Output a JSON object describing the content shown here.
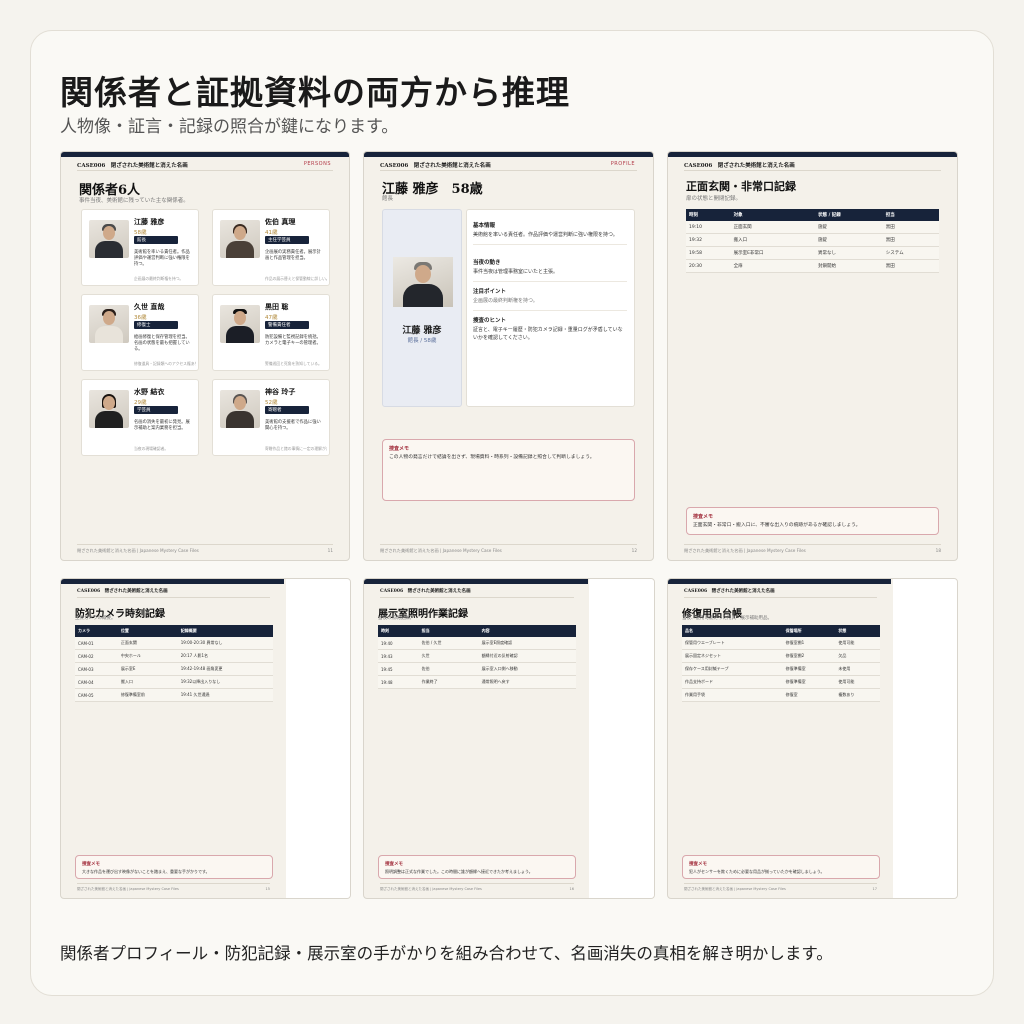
{
  "headline": "関係者と証拠資料の両方から推理",
  "subhead": "人物像・証言・記録の照合が鍵になります。",
  "footer": "関係者プロフィール・防犯記録・展示室の手がかりを組み合わせて、名画消失の真相を解き明かします。",
  "common": {
    "case": "CASE006　閉ざされた美術館と消えた名画",
    "foot": "閉ざされた美術館と消えた名画 | Japanese Mystery Case Files",
    "memo_title": "捜査メモ"
  },
  "p1": {
    "tag": "PERSONS",
    "title": "関係者6人",
    "sub": "事件当夜、美術館に残っていた主な関係者。",
    "page": "11",
    "persons": [
      {
        "name": "江藤 雅彦",
        "age": "58歳",
        "role": "館長",
        "desc": "美術館を率いる責任者。作品評価や運営判断に強い権限を持つ。",
        "note": "企画展の最終判断権を持つ。"
      },
      {
        "name": "佐伯 真理",
        "age": "41歳",
        "role": "主任学芸員",
        "desc": "企画展の実務責任者。展示計画と作品管理を担当。",
        "note": "作品の展示替えと保管動線に詳しい。"
      },
      {
        "name": "久世 直哉",
        "age": "36歳",
        "role": "修復士",
        "desc": "絵画修復と保存管理を担当。名画の状態を最も把握している。",
        "note": "修復道具・記録類へのアクセス権あり。"
      },
      {
        "name": "黒田 聡",
        "age": "47歳",
        "role": "警備責任者",
        "desc": "防犯設備と監視記録を統括。カメラと電子キーの管理者。",
        "note": "警備巡回と死角を熟知している。"
      },
      {
        "name": "水野 結衣",
        "age": "29歳",
        "role": "学芸員",
        "desc": "名画の消失を最初に発見。展示補助と案内業務を担当。",
        "note": "当夜の現場確認者。"
      },
      {
        "name": "神谷 玲子",
        "age": "52歳",
        "role": "寄贈者",
        "desc": "美術館の支援者で作品に強い関心を持つ。",
        "note": "寄贈作品と館の事情に一定の理解がある。"
      }
    ]
  },
  "p2": {
    "tag": "PROFILE",
    "title": "江藤 雅彦　58歳",
    "sub": "館長",
    "page": "12",
    "photo_name": "江藤 雅彦",
    "photo_sub": "館長 / 58歳",
    "sections": [
      {
        "h": "基本情報",
        "b": "美術館を率いる責任者。作品評価や運営判断に強い権限を持つ。"
      },
      {
        "h": "当夜の動き",
        "b": "事件当夜は管理事務室にいたと主張。"
      },
      {
        "h": "注目ポイント",
        "b": "企画展の最終判断権を持つ。"
      },
      {
        "h": "捜査のヒント",
        "b": "証言と、電子キー履歴・防犯カメラ記録・重量ログが矛盾していないかを確認してください。"
      }
    ],
    "memo": "この人物の発言だけで結論を出さず、現場資料・時系列・設備記録と照合して判断しましょう。"
  },
  "p3": {
    "title": "正面玄関・非常口記録",
    "sub": "扉の状態と開閉記録。",
    "page": "18",
    "headers": [
      "時刻",
      "対象",
      "状態 / 記録",
      "担当"
    ],
    "rows": [
      [
        "19:10",
        "正面玄関",
        "施錠",
        "黒田"
      ],
      [
        "19:32",
        "搬入口",
        "施錠",
        "黒田"
      ],
      [
        "19:58",
        "展示室E非常口",
        "異常なし",
        "システム"
      ],
      [
        "20:30",
        "全扉",
        "封鎖開始",
        "黒田"
      ]
    ],
    "memo": "正面玄関・非常口・搬入口に、不審な出入りの痕跡があるか確認しましょう。"
  },
  "p4": {
    "title": "防犯カメラ時刻記録",
    "sub": "主要カメラの概要。",
    "page": "15",
    "headers": [
      "カメラ",
      "位置",
      "記録概要"
    ],
    "rows": [
      [
        "CAM-01",
        "正面玄関",
        "19:00-20:30 異常なし"
      ],
      [
        "CAM-02",
        "中央ホール",
        "20:17 人影1名"
      ],
      [
        "CAM-03",
        "展示室E",
        "19:42-19:48 画角変更"
      ],
      [
        "CAM-04",
        "搬入口",
        "19:32以降出入りなし"
      ],
      [
        "CAM-05",
        "修復準備室前",
        "19:41 久世通過"
      ]
    ],
    "memo": "大きな作品を運び出す映像がないことを踏まえ、重要な手がかりです。"
  },
  "p5": {
    "title": "展示室照明作業記録",
    "sub": "当夜の照明記録。",
    "page": "16",
    "headers": [
      "時刻",
      "担当",
      "内容"
    ],
    "rows": [
      [
        "19:40",
        "佐伯 / 久世",
        "展示室E照度確認"
      ],
      [
        "19:43",
        "久世",
        "額縁付近の反射確認"
      ],
      [
        "19:45",
        "佐伯",
        "展示室入口側へ移動"
      ],
      [
        "19:48",
        "作業終了",
        "通常照明へ戻す"
      ]
    ],
    "memo": "照明調整は正式な作業でした。この時間に誰が額縁へ接近できたか考えましょう。"
  },
  "p6": {
    "title": "修復用品台帳",
    "sub": "当夜、使用可能だった用具・展示補助用品。",
    "page": "17",
    "headers": [
      "品名",
      "保管場所",
      "状態"
    ],
    "rows": [
      [
        "保管用ウエーブレート",
        "修復室棚1",
        "使用可能"
      ],
      [
        "展示固定ネジセット",
        "修復室棚2",
        "欠品"
      ],
      [
        "保存ケース用封緘テープ",
        "修復準備室",
        "未使用"
      ],
      [
        "作品支持ボード",
        "修復準備室",
        "使用可能"
      ],
      [
        "作業用手袋",
        "修復室",
        "複数あり"
      ]
    ],
    "memo": "犯人がセンサーを欺くために必要な用品が揃っていたかを確認しましょう。"
  }
}
